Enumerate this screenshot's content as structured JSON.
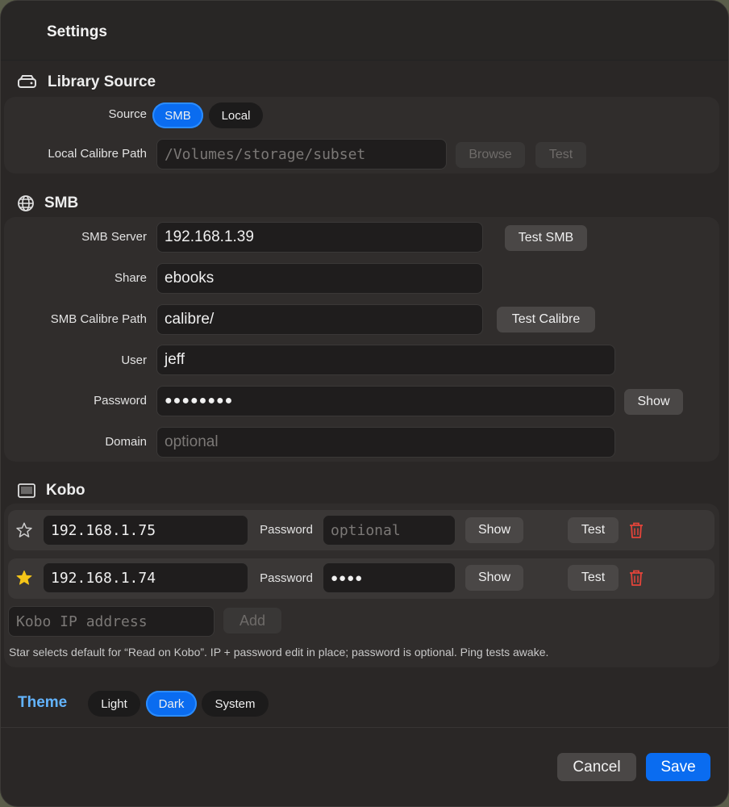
{
  "window": {
    "title": "Settings"
  },
  "library_source": {
    "heading": "Library Source",
    "source_label": "Source",
    "source_options": [
      "SMB",
      "Local"
    ],
    "source_selected": "SMB",
    "local_path_label": "Local Calibre Path",
    "local_path_placeholder": "/Volumes/storage/subset",
    "browse_label": "Browse",
    "test_label": "Test"
  },
  "smb": {
    "heading": "SMB",
    "server_label": "SMB Server",
    "server_value": "192.168.1.39",
    "test_smb_label": "Test SMB",
    "share_label": "Share",
    "share_value": "ebooks",
    "calibre_path_label": "SMB Calibre Path",
    "calibre_path_value": "calibre/",
    "test_calibre_label": "Test Calibre",
    "user_label": "User",
    "user_value": "jeff",
    "password_label": "Password",
    "password_value": "●●●●●●●●",
    "show_label": "Show",
    "domain_label": "Domain",
    "domain_placeholder": "optional"
  },
  "kobo": {
    "heading": "Kobo",
    "devices": [
      {
        "ip": "192.168.1.75",
        "password_label": "Password",
        "password_value": "",
        "password_placeholder": "optional",
        "show_label": "Show",
        "test_label": "Test",
        "default": false
      },
      {
        "ip": "192.168.1.74",
        "password_label": "Password",
        "password_value": "●●●●",
        "password_placeholder": "",
        "show_label": "Show",
        "test_label": "Test",
        "default": true
      }
    ],
    "add_placeholder": "Kobo IP address",
    "add_label": "Add",
    "hint": "Star selects default for “Read on Kobo”. IP + password edit in place; password is optional. Ping tests awake."
  },
  "theme": {
    "label": "Theme",
    "options": [
      "Light",
      "Dark",
      "System"
    ],
    "selected": "Dark"
  },
  "footer": {
    "cancel_label": "Cancel",
    "save_label": "Save"
  },
  "colors": {
    "accent": "#0a6cf0",
    "theme_label": "#63b4ff",
    "star": "#f5c518",
    "delete": "#e5443a"
  }
}
